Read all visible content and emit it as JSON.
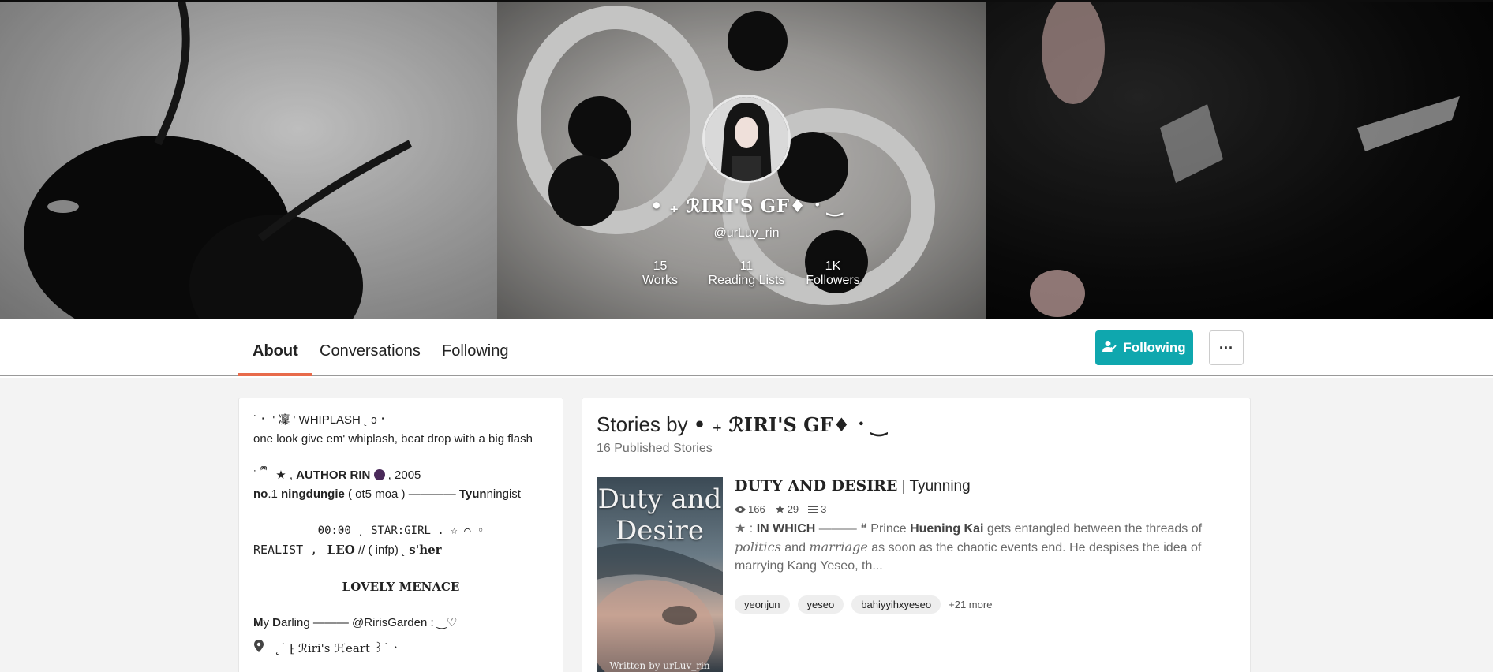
{
  "profile": {
    "display_name": "• ₊ ℛIRI'S GF♦ ⠂‿",
    "handle": "@urLuv_rin",
    "stats": [
      {
        "value": "15",
        "label": "Works"
      },
      {
        "value": "11",
        "label": "Reading Lists"
      },
      {
        "value": "1K",
        "label": "Followers"
      }
    ]
  },
  "nav": {
    "tabs": [
      "About",
      "Conversations",
      "Following"
    ],
    "active_tab": "About",
    "follow_label": "Following",
    "more_label": "···"
  },
  "about": {
    "line1": "˙ ⠂ ' 凜 ' WHIPLASH ˛ ɔ ⠂",
    "line2": "one look give em' whiplash, beat drop with a big flash",
    "line3_a": "˙ ྀི ⠀ ★ , ",
    "line3_b": "AUTHOR RIN",
    "line3_c": " , 2005",
    "line4_a": "no",
    "line4_b": ".1 ",
    "line4_c": "ningdungie",
    "line4_d": " ( ot5 moa ) ———— ",
    "line4_e": "Tyun",
    "line4_f": "ningist",
    "line5": "00:00 ˛ STAR:GIRL . ☆ ⌒ ◦",
    "line6_a": "REALIST ,",
    "line6_b": "LEO",
    "line6_c": " // ( infp) ˛ ",
    "line6_d": "s'her",
    "line7": "LOVELY MENACE",
    "line8_a": "M",
    "line8_b": "y ",
    "line8_c": "D",
    "line8_d": "arling ——— @RirisGarden : ‿♡",
    "location": "˛˙ ⁅ ℛiri's ℋeart ꒱˙ ⠂"
  },
  "stories": {
    "heading_prefix": "Stories by",
    "heading_name": "• ₊ ℛIRI'S GF♦ ⠂‿",
    "count": "16 Published Stories",
    "items": [
      {
        "title": "DUTY AND DESIRE",
        "subtitle": "| Tyunning",
        "cover_title": "Duty and Desire",
        "cover_byline": "Written by urLuv_rin",
        "reads": "166",
        "votes": "29",
        "parts": "3",
        "desc_a": "★ : ",
        "desc_b": "IN WHICH",
        "desc_c": " ——— ❝ Prince ",
        "desc_d": "Huening Kai",
        "desc_e": " gets entangled between the threads of ",
        "desc_f": "politics",
        "desc_g": " and ",
        "desc_h": "marriage",
        "desc_i": " as soon as the chaotic events end. He despises the idea of marrying Kang Yeseo, th...",
        "tags": [
          "yeonjun",
          "yeseo",
          "bahiyyihxyeseo"
        ],
        "more_tags": "+21 more"
      }
    ]
  }
}
